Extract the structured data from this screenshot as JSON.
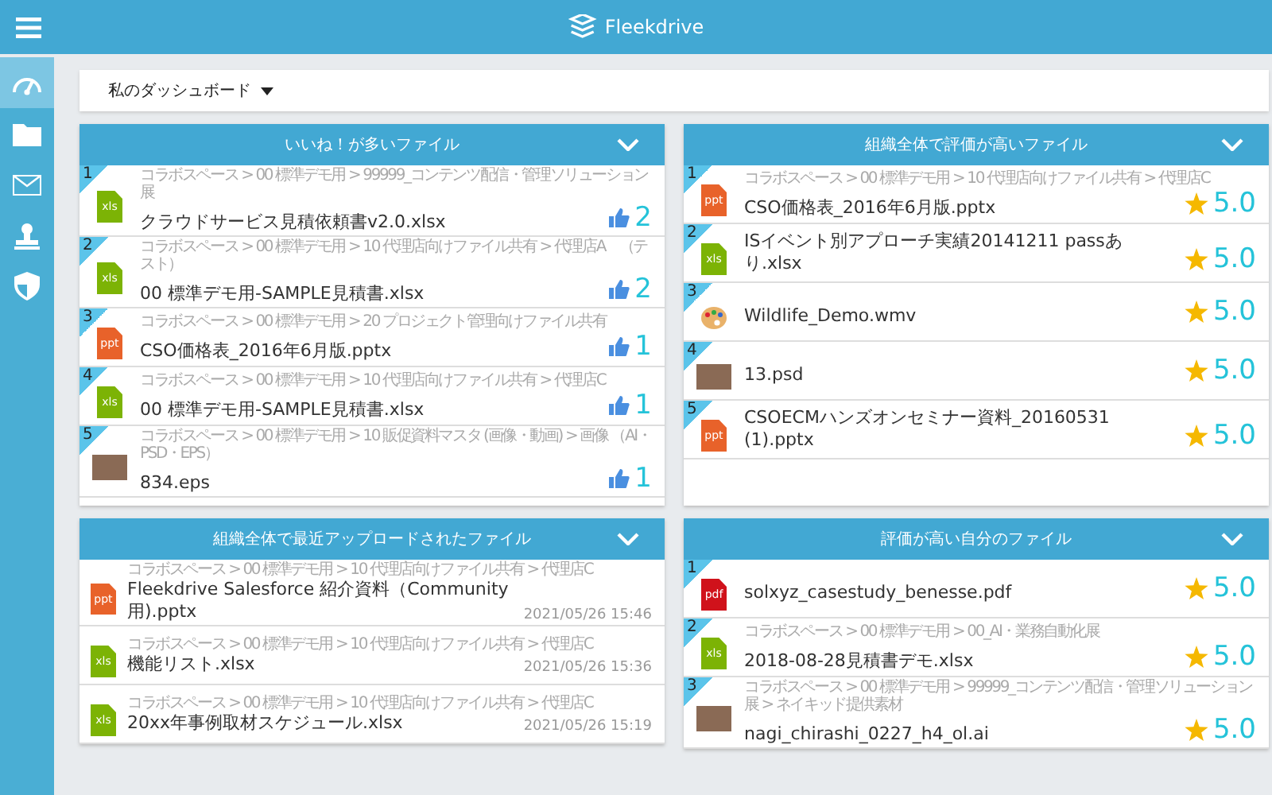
{
  "topbar": {
    "logo": "Fleekdrive"
  },
  "sidebar": {
    "items": [
      {
        "kind": "dashboard",
        "selected": true
      },
      {
        "kind": "folder",
        "selected": false
      },
      {
        "kind": "mail",
        "selected": false
      },
      {
        "kind": "stamp",
        "selected": false
      },
      {
        "kind": "shield",
        "selected": false
      }
    ]
  },
  "dashboard_selector": {
    "label": "私のダッシュボード"
  },
  "panels": [
    {
      "title": "いいね！が多いファイル",
      "kind": "likes",
      "rows": [
        {
          "rank": "1",
          "path": "コラボスペース > 00 標準デモ用 > 99999_コンテンツ配信・管理ソリューション展",
          "name": "クラウドサービス見積依頼書v2.0.xlsx",
          "kind": "document",
          "icon_label": "xls",
          "color": "#7cb305",
          "metric": "2"
        },
        {
          "rank": "2",
          "path": "コラボスペース > 00 標準デモ用 > 10 代理店向けファイル共有 > 代理店A　（テスト）",
          "name": "00 標準デモ用-SAMPLE見積書.xlsx",
          "kind": "document",
          "icon_label": "xls",
          "color": "#7cb305",
          "metric": "2"
        },
        {
          "rank": "3",
          "path": "コラボスペース > 00 標準デモ用 > 20 プロジェクト管理向けファイル共有",
          "name": "CSO価格表_2016年6月版.pptx",
          "kind": "document",
          "icon_label": "ppt",
          "color": "#e8622a",
          "metric": "1"
        },
        {
          "rank": "4",
          "path": "コラボスペース > 00 標準デモ用 > 10 代理店向けファイル共有 > 代理店C",
          "name": "00 標準デモ用-SAMPLE見積書.xlsx",
          "kind": "document",
          "icon_label": "xls",
          "color": "#7cb305",
          "metric": "1"
        },
        {
          "rank": "5",
          "path": "コラボスペース > 00 標準デモ用 > 10 販促資料マスタ (画像・動画) > 画像 （AI・PSD・EPS）",
          "name": "834.eps",
          "kind": "photo",
          "metric": "1"
        }
      ]
    },
    {
      "title": "組織全体で評価が高いファイル",
      "kind": "rating",
      "rows": [
        {
          "rank": "1",
          "path": "コラボスペース > 00 標準デモ用 > 10 代理店向けファイル共有 > 代理店C",
          "name": "CSO価格表_2016年6月版.pptx",
          "kind": "document",
          "icon_label": "ppt",
          "color": "#e8622a",
          "metric": "5.0"
        },
        {
          "rank": "2",
          "name": "ISイベント別アプローチ実績20141211 passあり.xlsx",
          "kind": "document",
          "icon_label": "xls",
          "color": "#7cb305",
          "metric": "5.0"
        },
        {
          "rank": "3",
          "name": "Wildlife_Demo.wmv",
          "kind": "media",
          "metric": "5.0"
        },
        {
          "rank": "4",
          "name": "13.psd",
          "kind": "photo",
          "metric": "5.0"
        },
        {
          "rank": "5",
          "name": "CSOECMハンズオンセミナー資料_20160531 (1).pptx",
          "kind": "document",
          "icon_label": "ppt",
          "color": "#e8622a",
          "metric": "5.0"
        }
      ]
    },
    {
      "title": "組織全体で最近アップロードされたファイル",
      "kind": "recent",
      "rows": [
        {
          "path": "コラボスペース > 00 標準デモ用 > 10 代理店向けファイル共有 > 代理店C",
          "name": "Fleekdrive Salesforce 紹介資料（Community用).pptx",
          "kind": "document",
          "icon_label": "ppt",
          "color": "#e8622a",
          "metric": "2021/05/26 15:46"
        },
        {
          "path": "コラボスペース > 00 標準デモ用 > 10 代理店向けファイル共有 > 代理店C",
          "name": "機能リスト.xlsx",
          "kind": "document",
          "icon_label": "xls",
          "color": "#7cb305",
          "metric": "2021/05/26 15:36"
        },
        {
          "path": "コラボスペース > 00 標準デモ用 > 10 代理店向けファイル共有 > 代理店C",
          "name": "20xx年事例取材スケジュール.xlsx",
          "kind": "document",
          "icon_label": "xls",
          "color": "#7cb305",
          "metric": "2021/05/26 15:19"
        }
      ]
    },
    {
      "title": "評価が高い自分のファイル",
      "kind": "rating",
      "rows": [
        {
          "rank": "1",
          "name": "solxyz_casestudy_benesse.pdf",
          "kind": "document",
          "icon_label": "pdf",
          "color": "#d0121b",
          "metric": "5.0"
        },
        {
          "rank": "2",
          "path": "コラボスペース > 00 標準デモ用 > 00_AI・業務自動化展",
          "name": "2018-08-28見積書デモ.xlsx",
          "kind": "document",
          "icon_label": "xls",
          "color": "#7cb305",
          "metric": "5.0"
        },
        {
          "rank": "3",
          "path": "コラボスペース > 00 標準デモ用 > 99999_コンテンツ配信・管理ソリューション展 > ネイキッド提供素材",
          "name": "nagi_chirashi_0227_h4_ol.ai",
          "kind": "photo",
          "metric": "5.0"
        }
      ]
    }
  ]
}
